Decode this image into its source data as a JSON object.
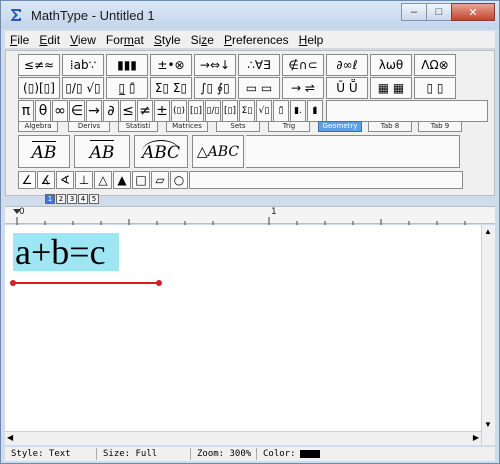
{
  "window": {
    "title": "MathType - Untitled 1",
    "controls": {
      "minimize": "–",
      "maximize": "□",
      "close": "✕"
    }
  },
  "menu": [
    {
      "pre": "",
      "key": "F",
      "post": "ile"
    },
    {
      "pre": "",
      "key": "E",
      "post": "dit"
    },
    {
      "pre": "",
      "key": "V",
      "post": "iew"
    },
    {
      "pre": "For",
      "key": "m",
      "post": "at"
    },
    {
      "pre": "",
      "key": "S",
      "post": "tyle"
    },
    {
      "pre": "Si",
      "key": "z",
      "post": "e"
    },
    {
      "pre": "",
      "key": "P",
      "post": "references"
    },
    {
      "pre": "",
      "key": "H",
      "post": "elp"
    }
  ],
  "palettes_row1": [
    "≤≠≈",
    "⁞ab∵",
    "▮▮▮",
    "±•⊗",
    "→⇔↓",
    "∴∀∃",
    "∉∩⊂",
    "∂∞ℓ",
    "λωθ",
    "ΛΩ⊗"
  ],
  "palettes_row2": [
    "(▯)[▯]",
    "▯/▯ √▯",
    "▯̲ ▯̄",
    "Σ▯ Σ▯",
    "∫▯ ∮▯",
    "▭ ▭",
    "→ ⇌",
    "Ū Ṻ",
    "▦ ▦",
    "▯ ▯"
  ],
  "palettes_row3": [
    "π",
    "θ",
    "∞",
    "∈",
    "→",
    "∂",
    "≤",
    "≠",
    "±",
    "(▯)",
    "[▯]",
    "▯/▯",
    "[▯]",
    "Σ▯",
    "√▯",
    "▯̄",
    "▮.",
    "▮̇"
  ],
  "tabs": [
    "Algebra",
    "Derivs",
    "Statisti",
    "Matrices",
    "Sets",
    "Trig",
    "Geometry",
    "Tab 8",
    "Tab 9"
  ],
  "active_tab": "Geometry",
  "templates": [
    "AB",
    "AB",
    "ABC",
    "△ABC"
  ],
  "shapes": [
    "∠",
    "∡",
    "∢",
    "⊥",
    "△",
    "▲",
    "□",
    "▱",
    "○"
  ],
  "zoom_tabs": [
    "1",
    "2",
    "3",
    "4",
    "5"
  ],
  "ruler": {
    "labels": [
      "0",
      "1"
    ]
  },
  "equation": {
    "text": "a+b=c"
  },
  "status": {
    "style": "Style: Text",
    "size": "Size: Full",
    "zoom": "Zoom: 300%",
    "color": "Color:"
  },
  "colors": {
    "highlight": "#9fe6f4",
    "underline": "#d21f1f",
    "active_tab": "#5e9ee6"
  }
}
